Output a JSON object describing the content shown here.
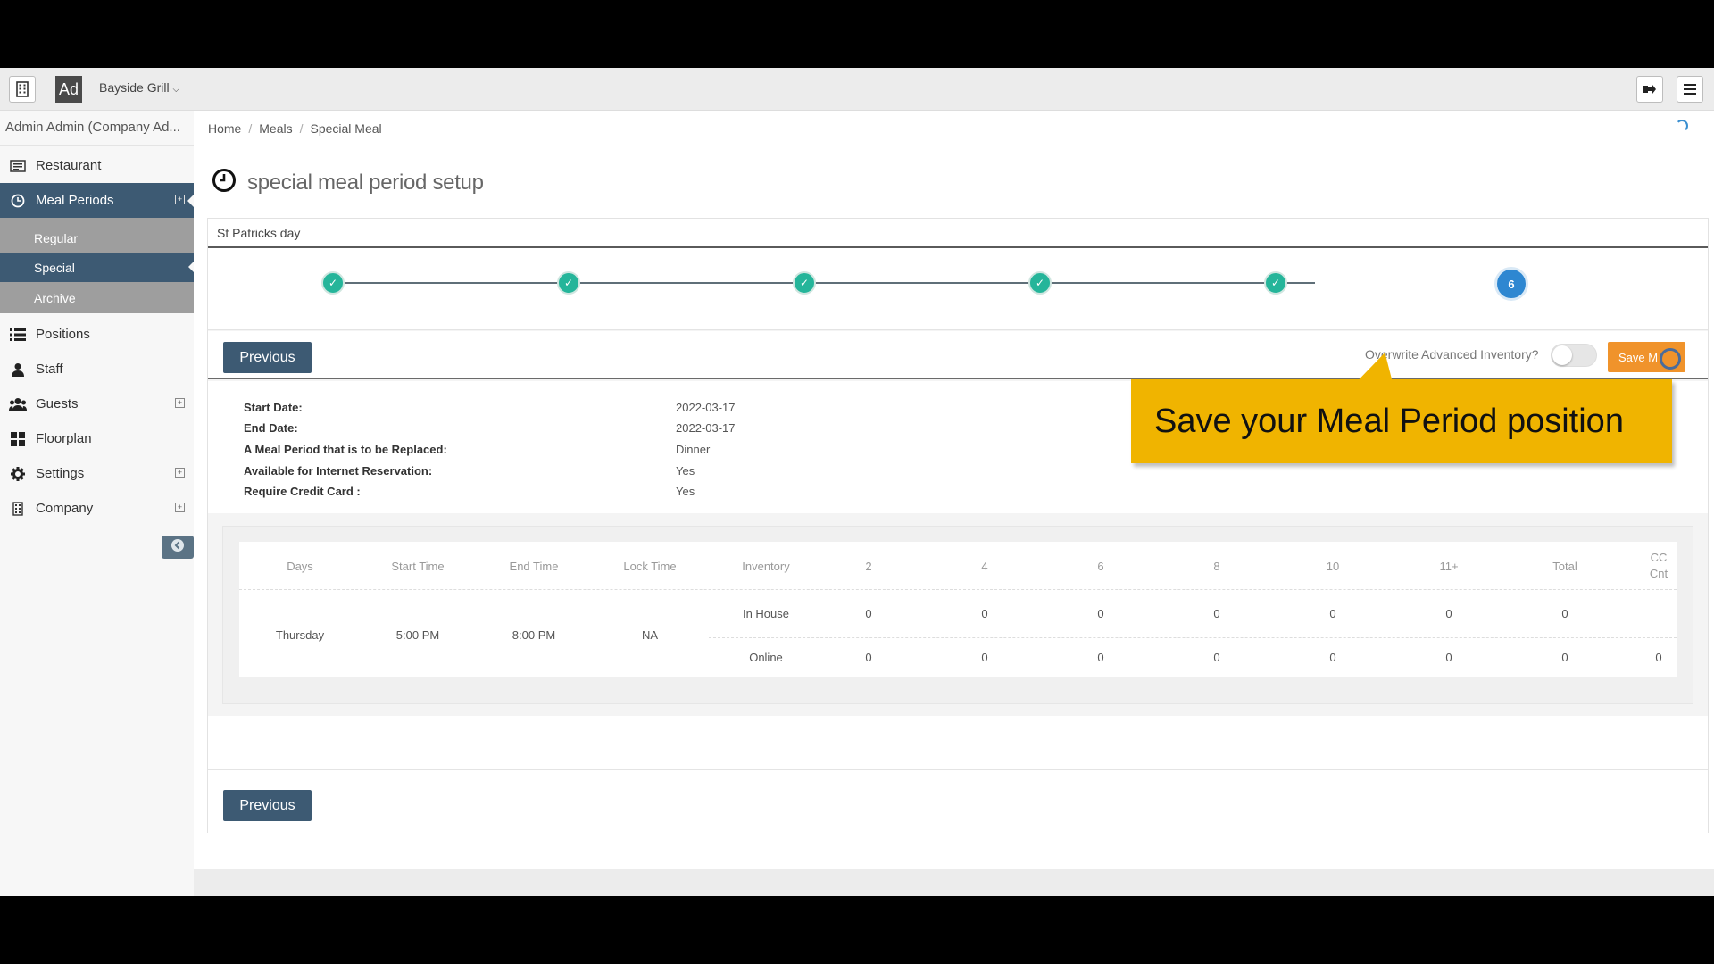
{
  "topbar": {
    "logo_badge": "Ad",
    "restaurant_name": "Bayside Grill",
    "icons": [
      "building-icon",
      "dropdown-chevron-icon",
      "logout-icon",
      "hamburger-menu-icon"
    ]
  },
  "sidebar": {
    "user": "Admin Admin (Company Ad...",
    "items": [
      {
        "label": "Restaurant",
        "icon": "list-card-icon"
      },
      {
        "label": "Meal Periods",
        "icon": "clock-icon",
        "active": true,
        "expandable": true
      },
      {
        "label": "Positions",
        "icon": "list-icon"
      },
      {
        "label": "Staff",
        "icon": "user-icon"
      },
      {
        "label": "Guests",
        "icon": "users-icon",
        "expandable": true
      },
      {
        "label": "Floorplan",
        "icon": "grid-icon"
      },
      {
        "label": "Settings",
        "icon": "gear-icon",
        "expandable": true
      },
      {
        "label": "Company",
        "icon": "building-icon",
        "expandable": true
      }
    ],
    "sub_items": [
      {
        "label": "Regular"
      },
      {
        "label": "Special",
        "active": true
      },
      {
        "label": "Archive"
      }
    ]
  },
  "breadcrumb": [
    "Home",
    "Meals",
    "Special Meal"
  ],
  "page": {
    "title": "special meal period setup",
    "panel_title": "St Patricks day",
    "wizard": {
      "total_steps": 6,
      "current_step": "6",
      "completed_steps": 5
    },
    "previous_label": "Previous",
    "overwrite_label": "Overwrite Advanced Inventory?",
    "overwrite_enabled": false,
    "save_label": "Save M"
  },
  "details": [
    {
      "label": "Start Date:",
      "value": "2022-03-17"
    },
    {
      "label": "End Date:",
      "value": "2022-03-17"
    },
    {
      "label": "A Meal Period that is to be Replaced:",
      "value": "Dinner"
    },
    {
      "label": "Available for Internet Reservation:",
      "value": "Yes"
    },
    {
      "label": "Require Credit Card :",
      "value": "Yes"
    }
  ],
  "callout": {
    "text": "Save your Meal Period position",
    "color": "#f0b400"
  },
  "table": {
    "headers": [
      "Days",
      "Start Time",
      "End Time",
      "Lock Time",
      "Inventory",
      "2",
      "4",
      "6",
      "8",
      "10",
      "11+",
      "Total",
      "CC",
      "Cnt"
    ],
    "row": {
      "day": "Thursday",
      "start": "5:00 PM",
      "end": "8:00 PM",
      "lock": "NA",
      "inventory": [
        {
          "type": "In House",
          "values": [
            "0",
            "0",
            "0",
            "0",
            "0",
            "0",
            "0"
          ],
          "cc": ""
        },
        {
          "type": "Online",
          "values": [
            "0",
            "0",
            "0",
            "0",
            "0",
            "0",
            "0"
          ],
          "cc": "0"
        }
      ]
    }
  },
  "colors": {
    "nav_active": "#3d5a73",
    "step_done": "#25b59a",
    "step_current": "#2e87d1",
    "save_button": "#f0932b"
  }
}
